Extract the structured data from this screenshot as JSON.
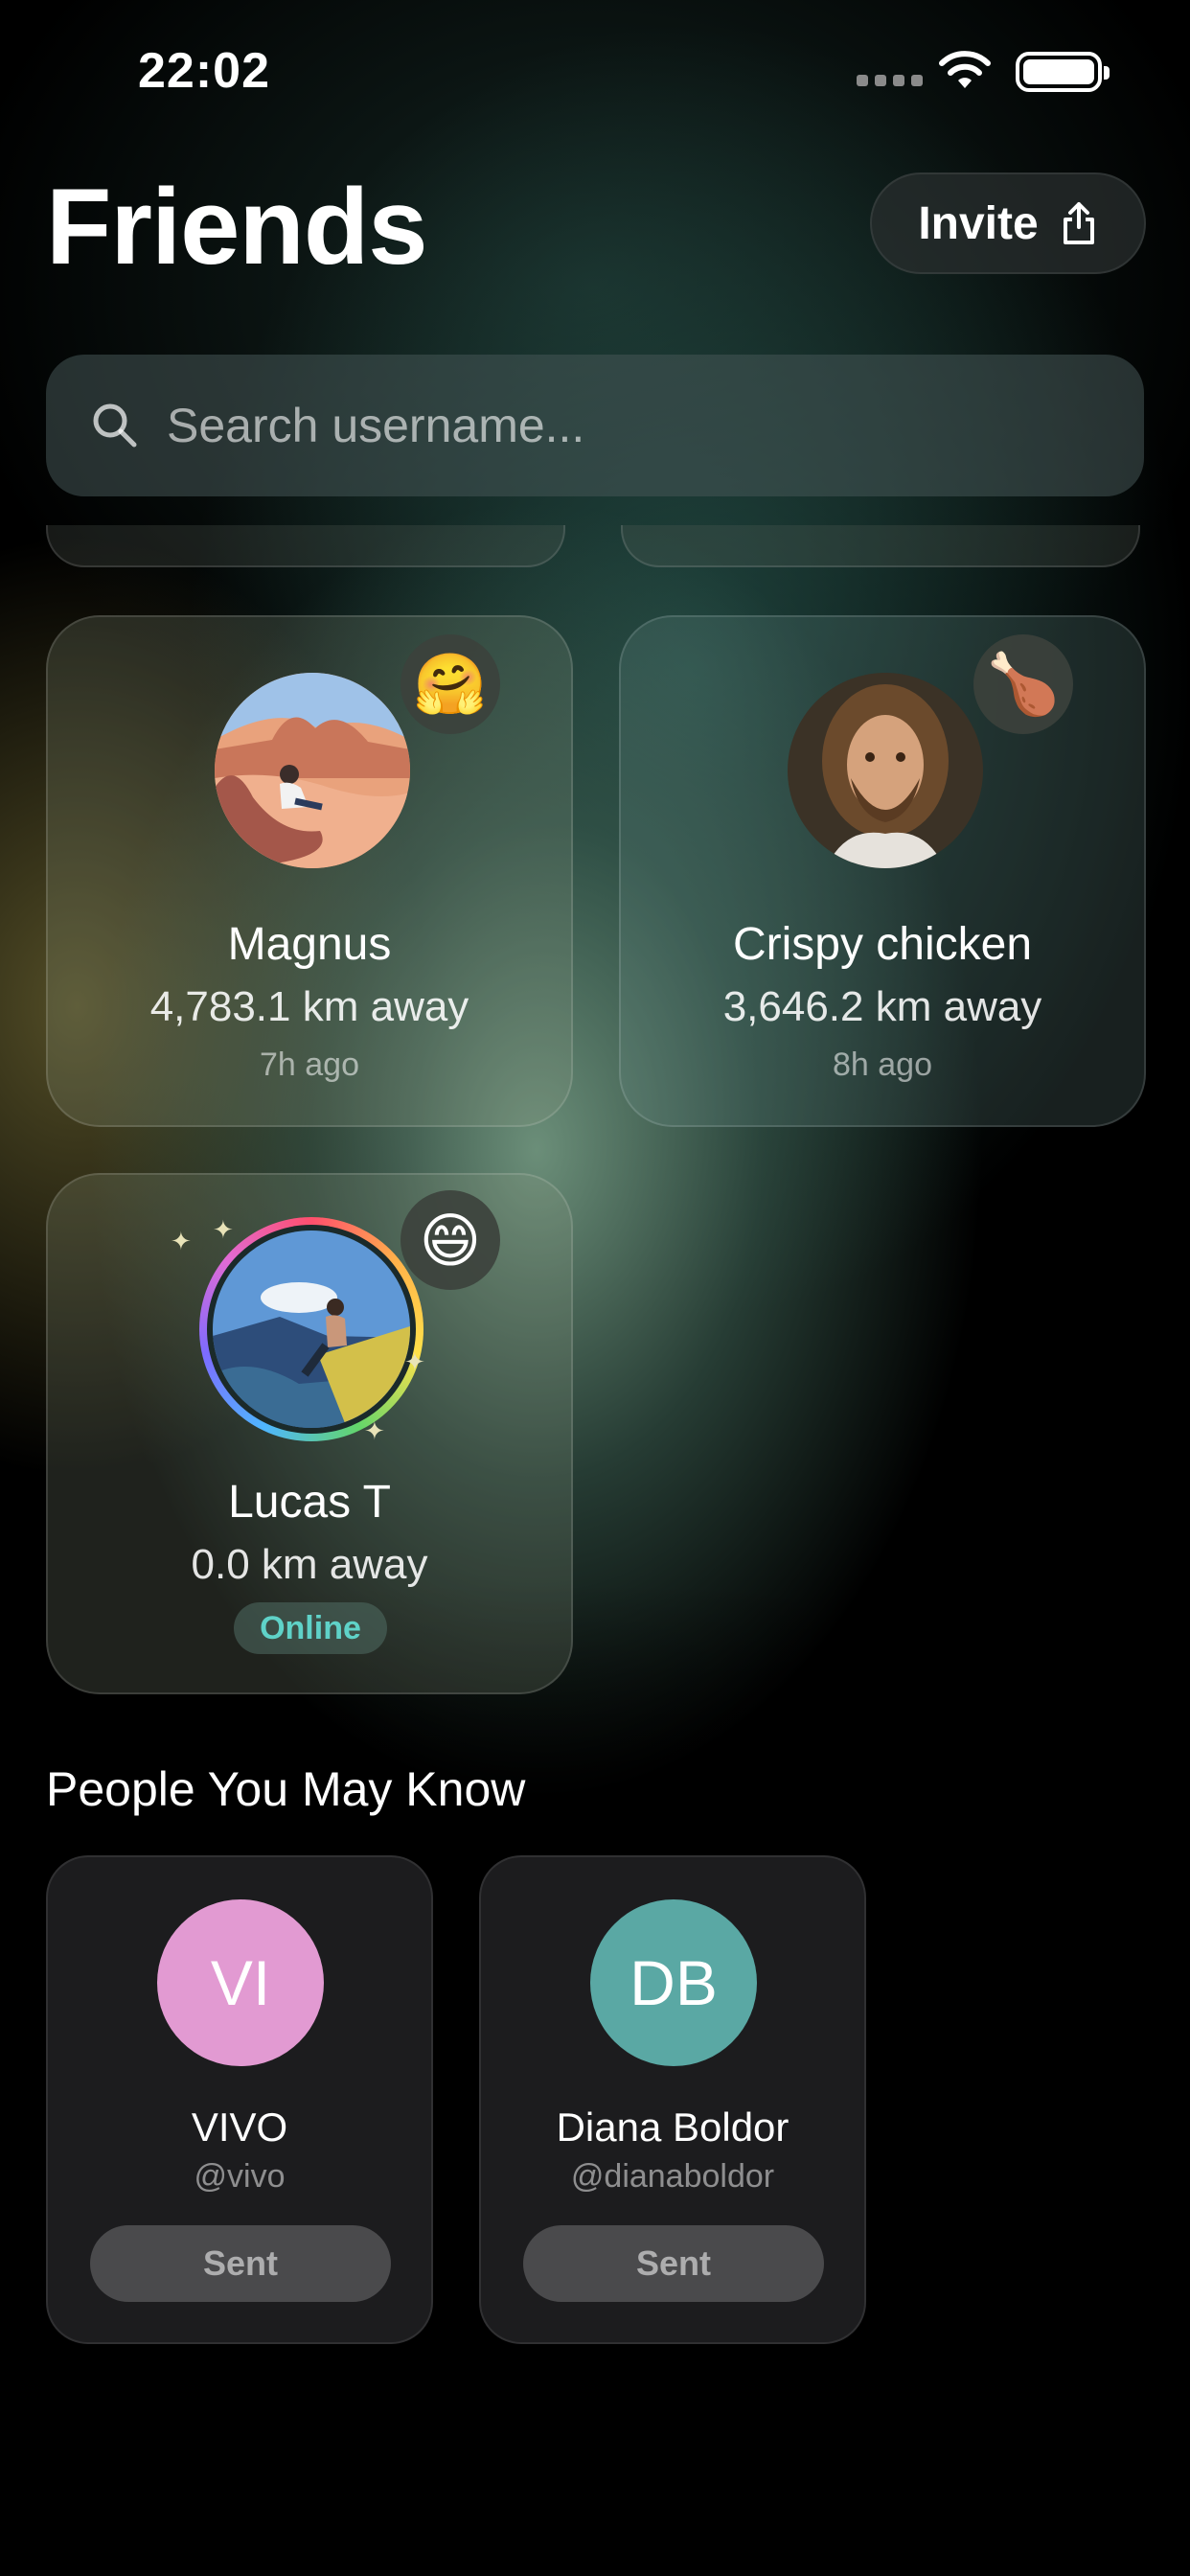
{
  "status_bar": {
    "time": "22:02"
  },
  "header": {
    "title": "Friends",
    "invite_label": "Invite"
  },
  "search": {
    "placeholder": "Search username..."
  },
  "friends": [
    {
      "name": "Magnus",
      "distance": "4,783.1 km away",
      "last_seen": "7h ago",
      "emoji": "🤗"
    },
    {
      "name": "Crispy chicken",
      "distance": "3,646.2 km away",
      "last_seen": "8h ago",
      "emoji": "🍗"
    },
    {
      "name": "Lucas T",
      "distance": "0.0 km away",
      "status": "Online",
      "emoji": "😄"
    }
  ],
  "suggestions": {
    "title": "People You May Know",
    "people": [
      {
        "initials": "VI",
        "name": "VIVO",
        "handle": "@vivo",
        "action": "Sent",
        "color": "#e29ad2"
      },
      {
        "initials": "DB",
        "name": "Diana Boldor",
        "handle": "@dianaboldor",
        "action": "Sent",
        "color": "#5aa8a4"
      }
    ]
  },
  "colors": {
    "online": "#5fd2c8",
    "background": "#000000"
  }
}
